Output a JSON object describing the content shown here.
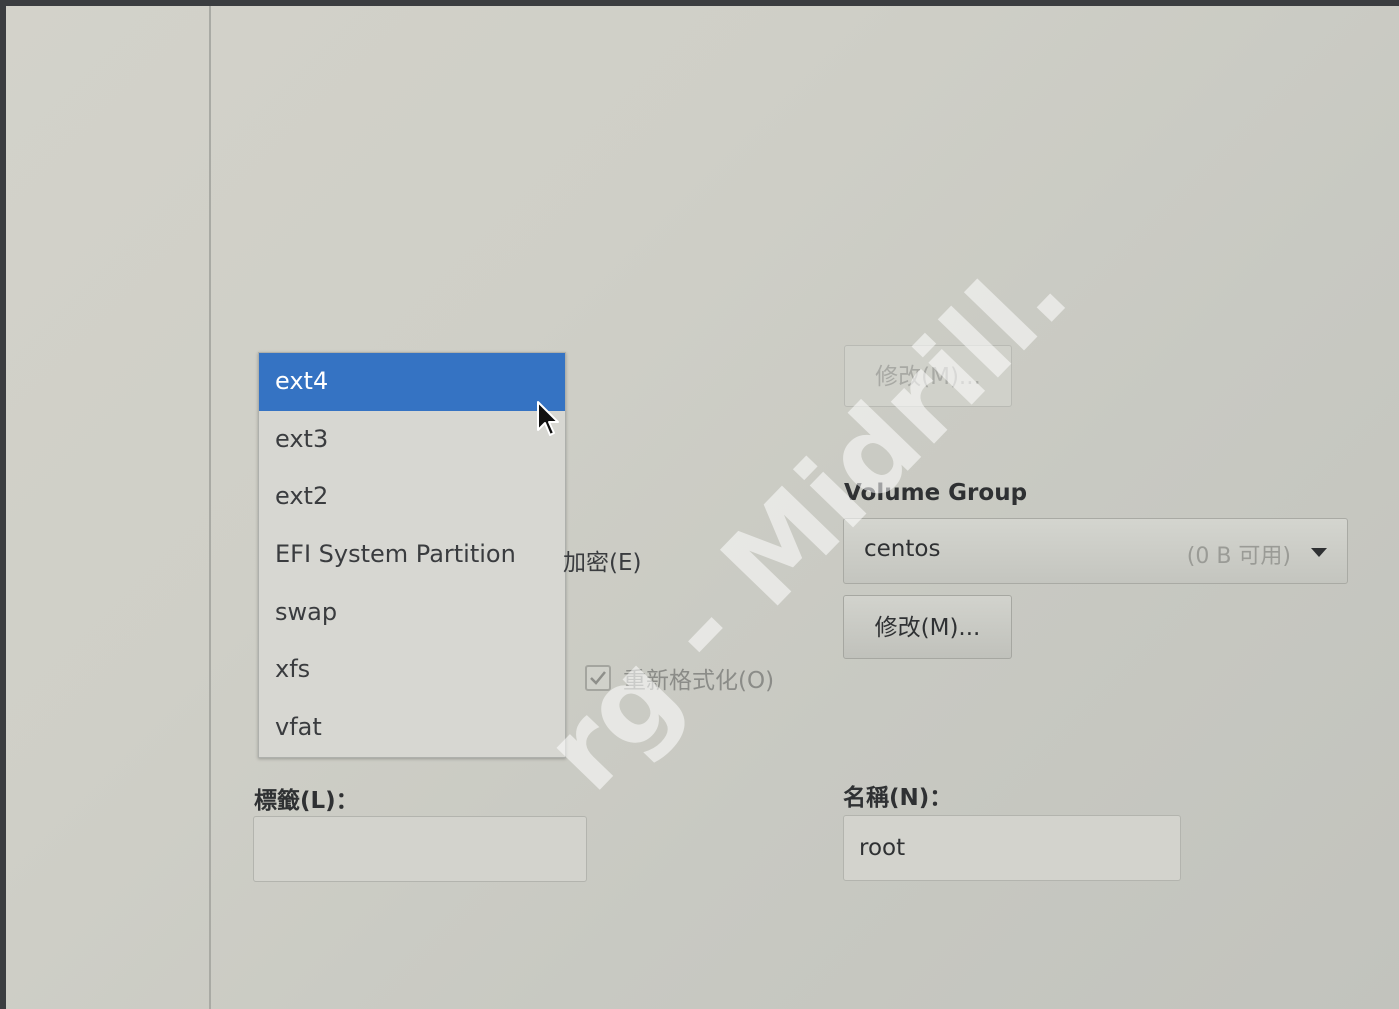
{
  "filesystem_dropdown": {
    "items": [
      {
        "label": "ext4",
        "selected": true
      },
      {
        "label": "ext3",
        "selected": false
      },
      {
        "label": "ext2",
        "selected": false
      },
      {
        "label": "EFI System Partition",
        "selected": false
      },
      {
        "label": "swap",
        "selected": false
      },
      {
        "label": "xfs",
        "selected": false
      },
      {
        "label": "vfat",
        "selected": false
      }
    ]
  },
  "encrypt": {
    "label": "加密(E)"
  },
  "reformat": {
    "label": "重新格式化(O)",
    "checked": true
  },
  "label_field": {
    "label": "標籤(L)：",
    "value": ""
  },
  "modify_top": {
    "label": "修改(M)...",
    "enabled": false
  },
  "volume_group": {
    "label": "Volume Group",
    "selected": "centos",
    "available": "(0 B 可用)"
  },
  "modify_vg": {
    "label": "修改(M)..."
  },
  "name_field": {
    "label": "名稱(N)：",
    "value": "root"
  },
  "watermark": {
    "text": "rg - Midrill."
  },
  "colors": {
    "selection": "#3573c3",
    "background": "#cfcfc7"
  }
}
